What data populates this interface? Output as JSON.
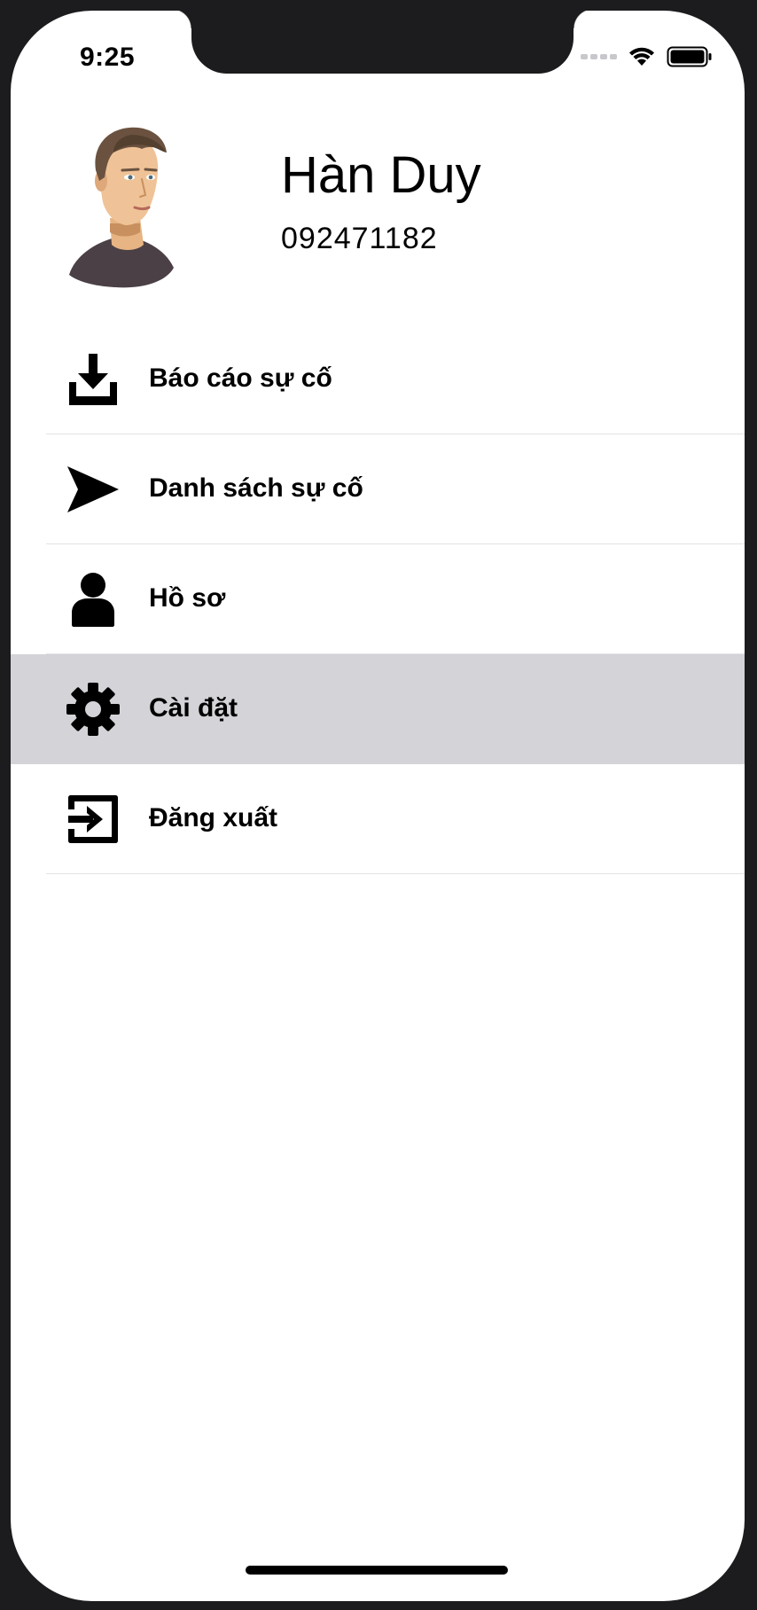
{
  "status_bar": {
    "time": "9:25",
    "icons": [
      "signal-dots-icon",
      "wifi-icon",
      "battery-icon"
    ]
  },
  "profile": {
    "name": "Hàn Duy",
    "phone": "092471182",
    "avatar_icon": "avatar-illustration"
  },
  "menu": {
    "items": [
      {
        "label": "Báo cáo sự cố",
        "icon": "download-icon",
        "selected": false
      },
      {
        "label": "Danh sách sự cố",
        "icon": "send-arrow-icon",
        "selected": false
      },
      {
        "label": "Hồ sơ",
        "icon": "user-icon",
        "selected": false
      },
      {
        "label": "Cài đặt",
        "icon": "gear-icon",
        "selected": true
      },
      {
        "label": "Đăng xuất",
        "icon": "logout-icon",
        "selected": false
      }
    ]
  },
  "colors": {
    "selected_row": "#d3d3d8",
    "divider": "#e3e3e6",
    "bezel": "#1c1c1e"
  }
}
